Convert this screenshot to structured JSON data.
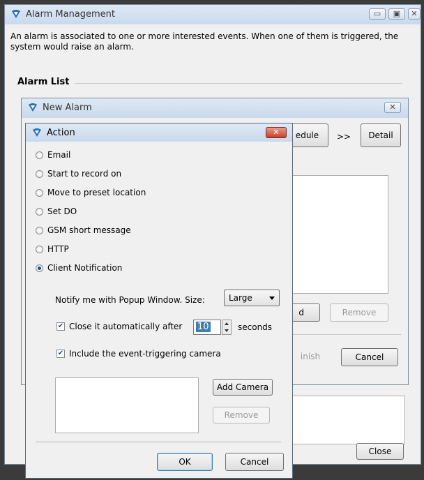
{
  "main_window": {
    "title": "Alarm Management",
    "controls": {
      "minimize": "▭",
      "maximize": "▣",
      "close": "✕"
    },
    "description": "An alarm is associated to one or more interested events. When one of them is triggered, the system would raise an alarm.",
    "section_title": "Alarm List",
    "close_button": "Close"
  },
  "new_alarm": {
    "title": "New Alarm",
    "close_icon": "✕",
    "schedule_tab": "edule",
    "arrows": ">>",
    "detail_tab": "Detail",
    "add_button_fragment": "d",
    "remove_button": "Remove",
    "finish_button_fragment": "inish",
    "cancel_button": "Cancel"
  },
  "action": {
    "title": "Action",
    "close_icon": "✕",
    "options": [
      {
        "label": "Email",
        "selected": false
      },
      {
        "label": "Start to record on",
        "selected": false
      },
      {
        "label": "Move to preset location",
        "selected": false
      },
      {
        "label": "Set DO",
        "selected": false
      },
      {
        "label": "GSM short message",
        "selected": false
      },
      {
        "label": "HTTP",
        "selected": false
      },
      {
        "label": "Client Notification",
        "selected": true
      }
    ],
    "notify_label": "Notify me with  Popup Window.  Size:",
    "size_value": "Large",
    "close_auto_label": "Close it automatically after",
    "close_auto_checked": true,
    "seconds_value": "10",
    "seconds_label": "seconds",
    "include_camera_label": "Include the event-triggering camera",
    "include_camera_checked": true,
    "add_camera_button": "Add Camera",
    "remove_button": "Remove",
    "ok_button": "OK",
    "cancel_button": "Cancel"
  },
  "colors": {
    "accent": "#3c7fb1",
    "title_bar": "#c9d9ec",
    "close_red": "#c9412c"
  }
}
